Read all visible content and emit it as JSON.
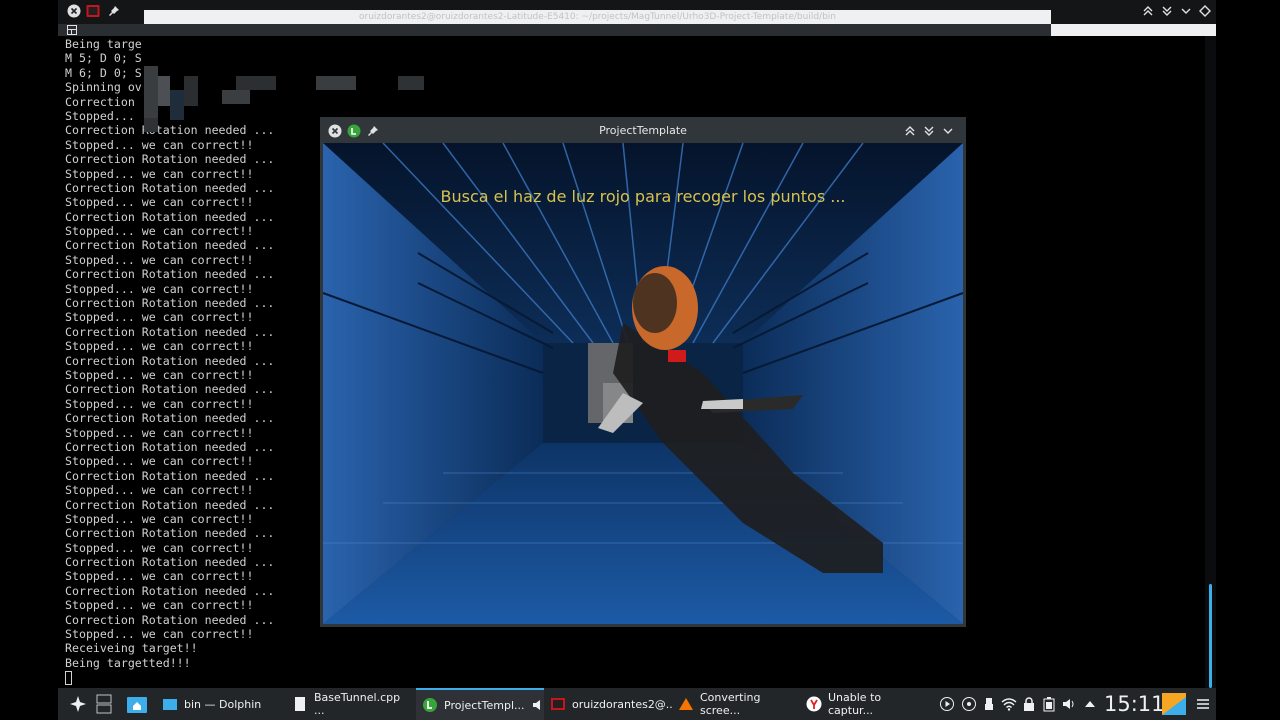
{
  "terminal": {
    "title": "oruizdorantes2@oruizdorantes2-Latitude-E5410: ~/projects/MagTunnel/Urho3D-Project-Template/build/bin",
    "lines": [
      "Being targe",
      "M 5; D 0; S",
      "M 6; D 0; S",
      "Spinning ov",
      "Correction ",
      "Stopped... ",
      "Correction Rotation needed ...",
      "Stopped... we can correct!!",
      "Correction Rotation needed ...",
      "Stopped... we can correct!!",
      "Correction Rotation needed ...",
      "Stopped... we can correct!!",
      "Correction Rotation needed ...",
      "Stopped... we can correct!!",
      "Correction Rotation needed ...",
      "Stopped... we can correct!!",
      "Correction Rotation needed ...",
      "Stopped... we can correct!!",
      "Correction Rotation needed ...",
      "Stopped... we can correct!!",
      "Correction Rotation needed ...",
      "Stopped... we can correct!!",
      "Correction Rotation needed ...",
      "Stopped... we can correct!!",
      "Correction Rotation needed ...",
      "Stopped... we can correct!!",
      "Correction Rotation needed ...",
      "Stopped... we can correct!!",
      "Correction Rotation needed ...",
      "Stopped... we can correct!!",
      "Correction Rotation needed ...",
      "Stopped... we can correct!!",
      "Correction Rotation needed ...",
      "Stopped... we can correct!!",
      "Correction Rotation needed ...",
      "Stopped... we can correct!!",
      "Correction Rotation needed ...",
      "Stopped... we can correct!!",
      "Correction Rotation needed ...",
      "Stopped... we can correct!!",
      "Correction Rotation needed ...",
      "Stopped... we can correct!!",
      "Receiveing target!!",
      "Being targetted!!!"
    ]
  },
  "game_window": {
    "title": "ProjectTemplate",
    "message": "Busca el haz de luz rojo para recoger los puntos ..."
  },
  "taskbar": {
    "tasks": [
      {
        "label": "bin — Dolphin",
        "icon": "folder-icon"
      },
      {
        "label": "BaseTunnel.cpp ...",
        "icon": "document-icon"
      },
      {
        "label": "ProjectTempl...",
        "icon": "app-icon",
        "active": true
      },
      {
        "label": "oruizdorantes2@...",
        "icon": "terminal-icon"
      },
      {
        "label": "Converting scree...",
        "icon": "converter-icon"
      },
      {
        "label": "Unable to captur...",
        "icon": "browser-icon"
      }
    ],
    "clock": "15:11"
  },
  "colors": {
    "accent": "#3daee9",
    "message": "#d8c24e",
    "panel": "#232629"
  }
}
